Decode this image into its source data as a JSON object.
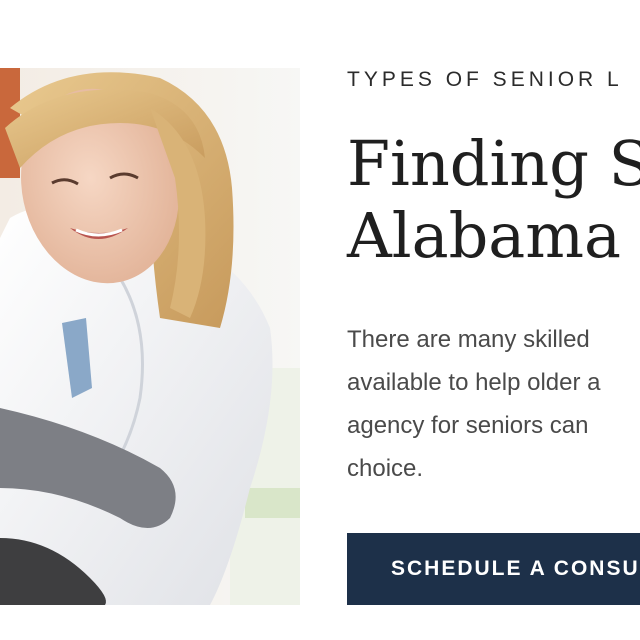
{
  "section": {
    "eyebrow": "TYPES OF SENIOR L",
    "heading_lines": [
      "Finding S",
      "Alabama"
    ],
    "body_lines": [
      "There are many skilled",
      "available to help older a",
      "agency for seniors can",
      "choice."
    ],
    "cta_label": "SCHEDULE A CONSU"
  },
  "colors": {
    "accent": "#1d3049",
    "heading": "#1f1f1f",
    "body": "#4a4a4a"
  }
}
